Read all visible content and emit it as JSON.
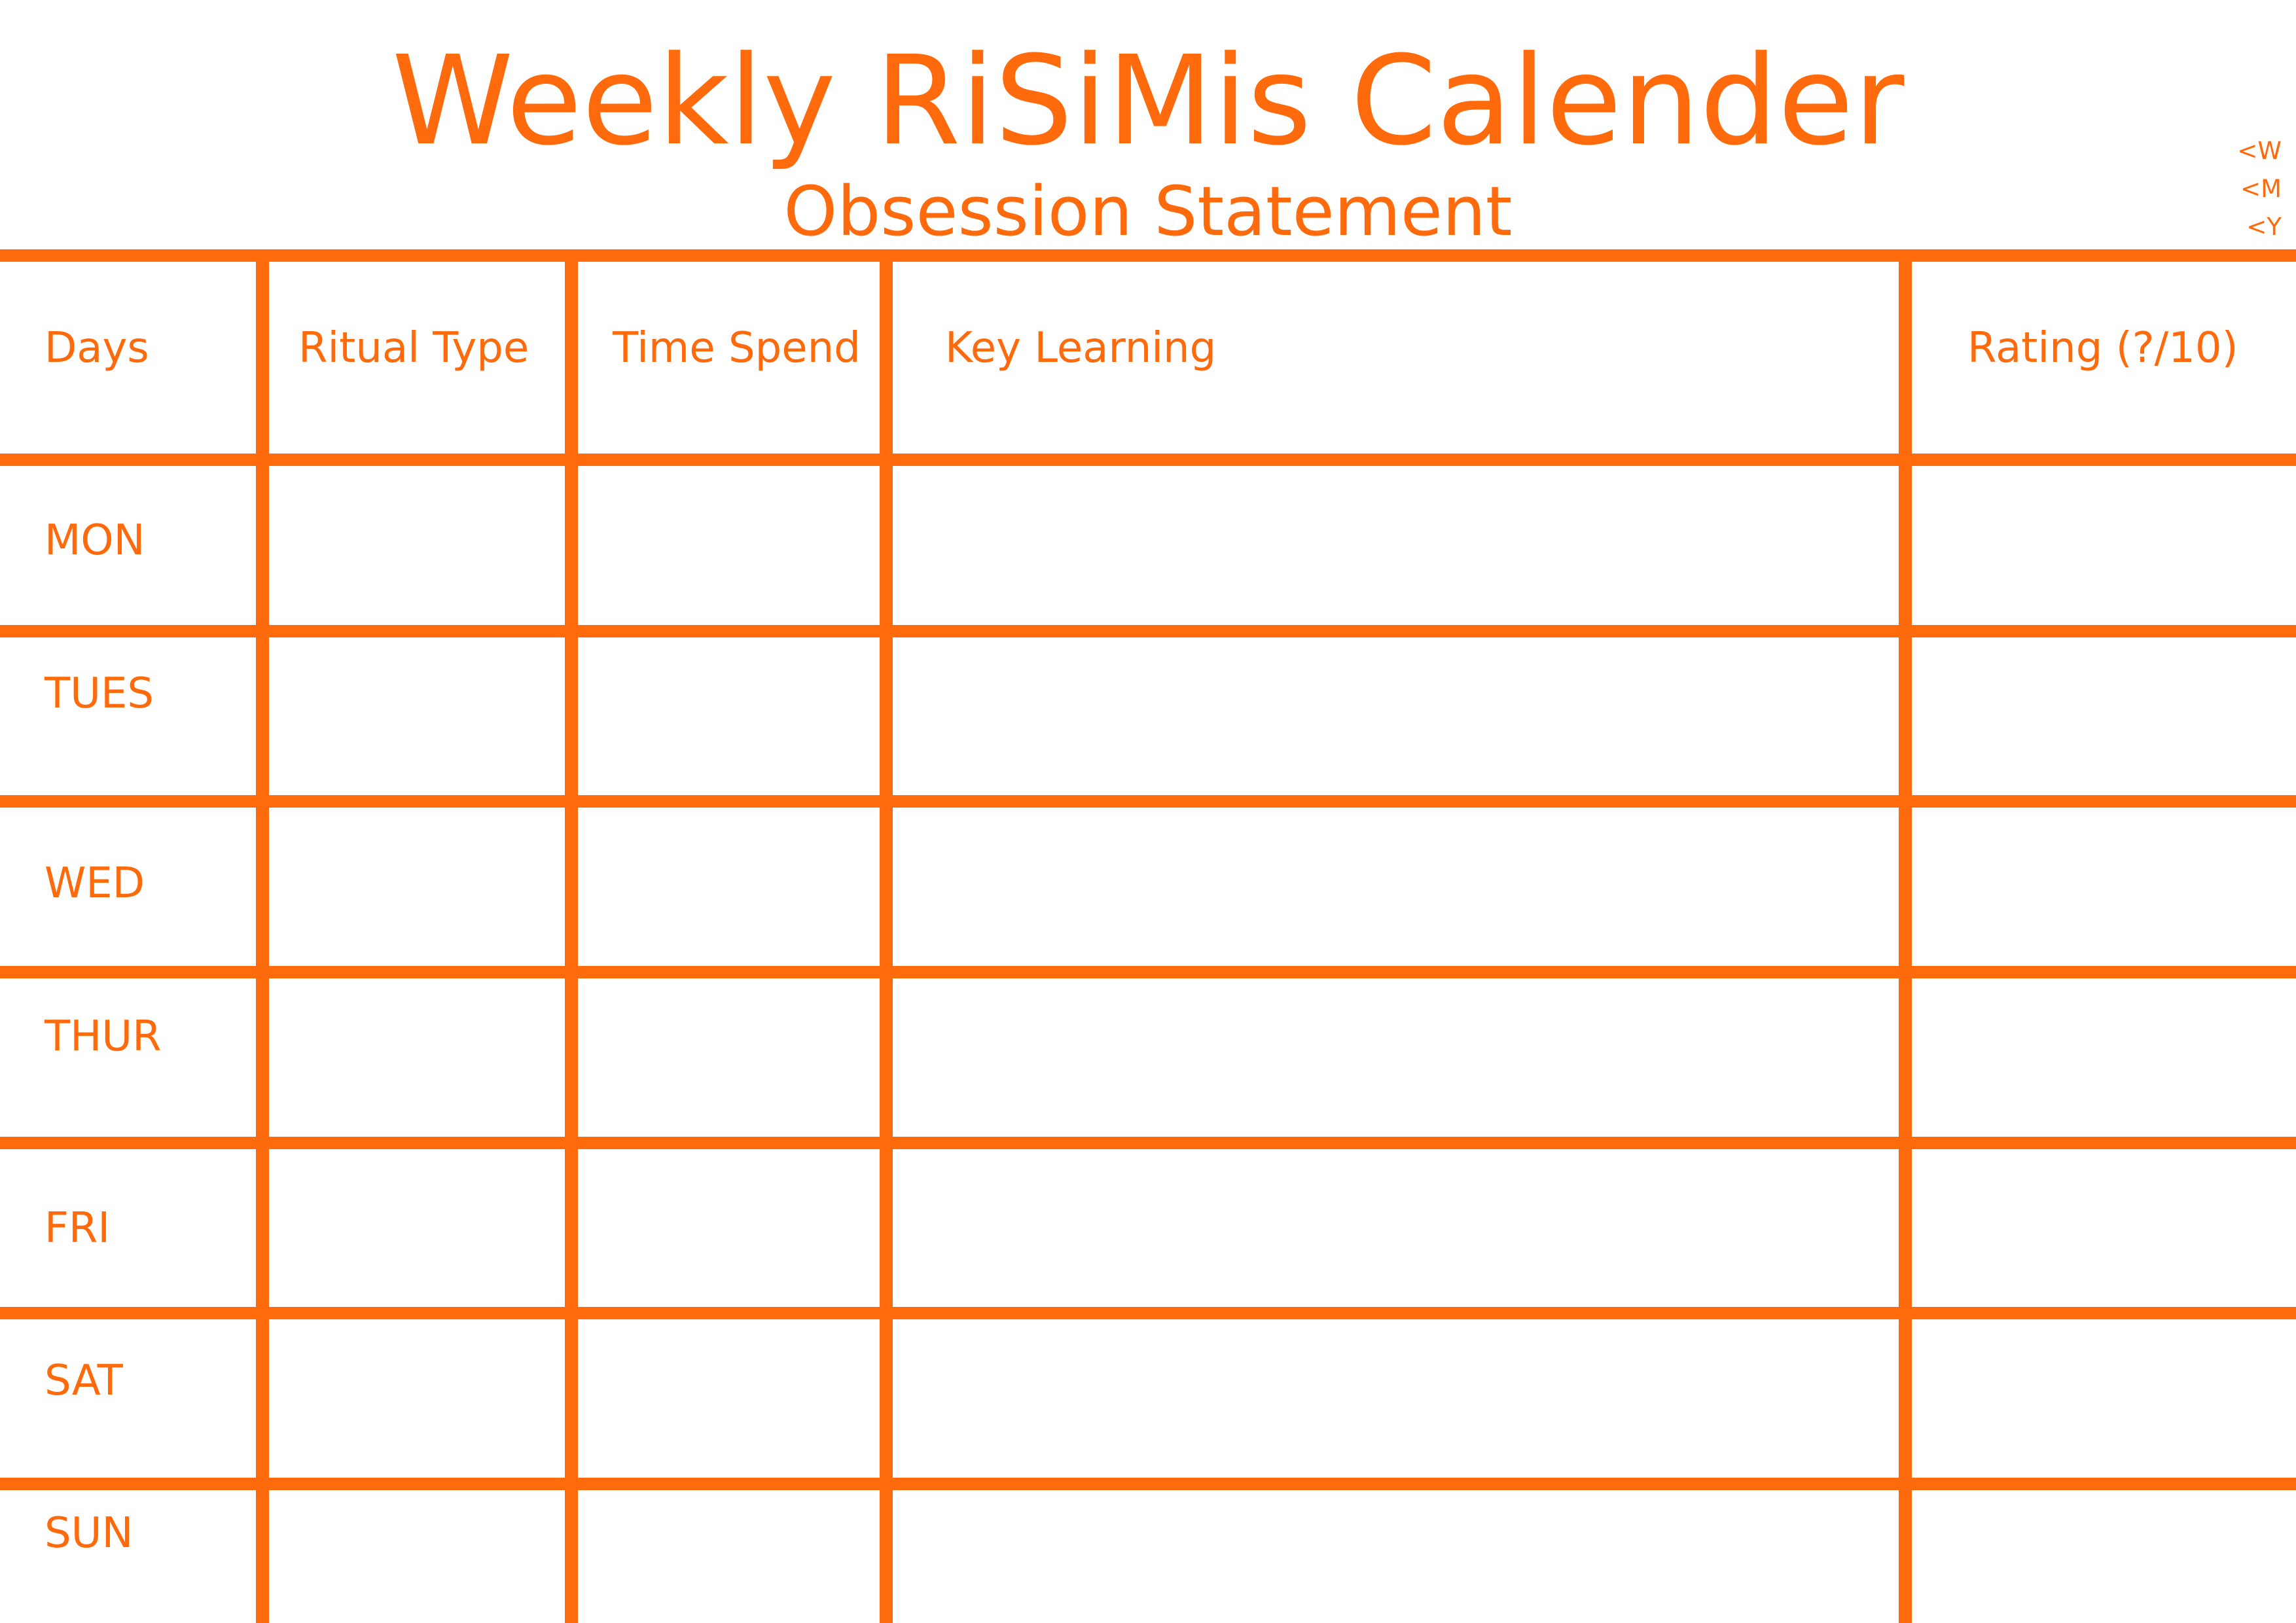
{
  "title": "Weekly RiSiMis Calender",
  "subtitle": "Obsession Statement",
  "nav": [
    "<W",
    "<M",
    "<Y"
  ],
  "accent_color": "#ff6a0d",
  "columns": [
    "Days",
    "Ritual Type",
    "Time Spend",
    "Key Learning",
    "Rating (?/10)"
  ],
  "days": [
    "MON",
    "TUES",
    "WED",
    "THUR",
    "FRI",
    "SAT",
    "SUN"
  ]
}
